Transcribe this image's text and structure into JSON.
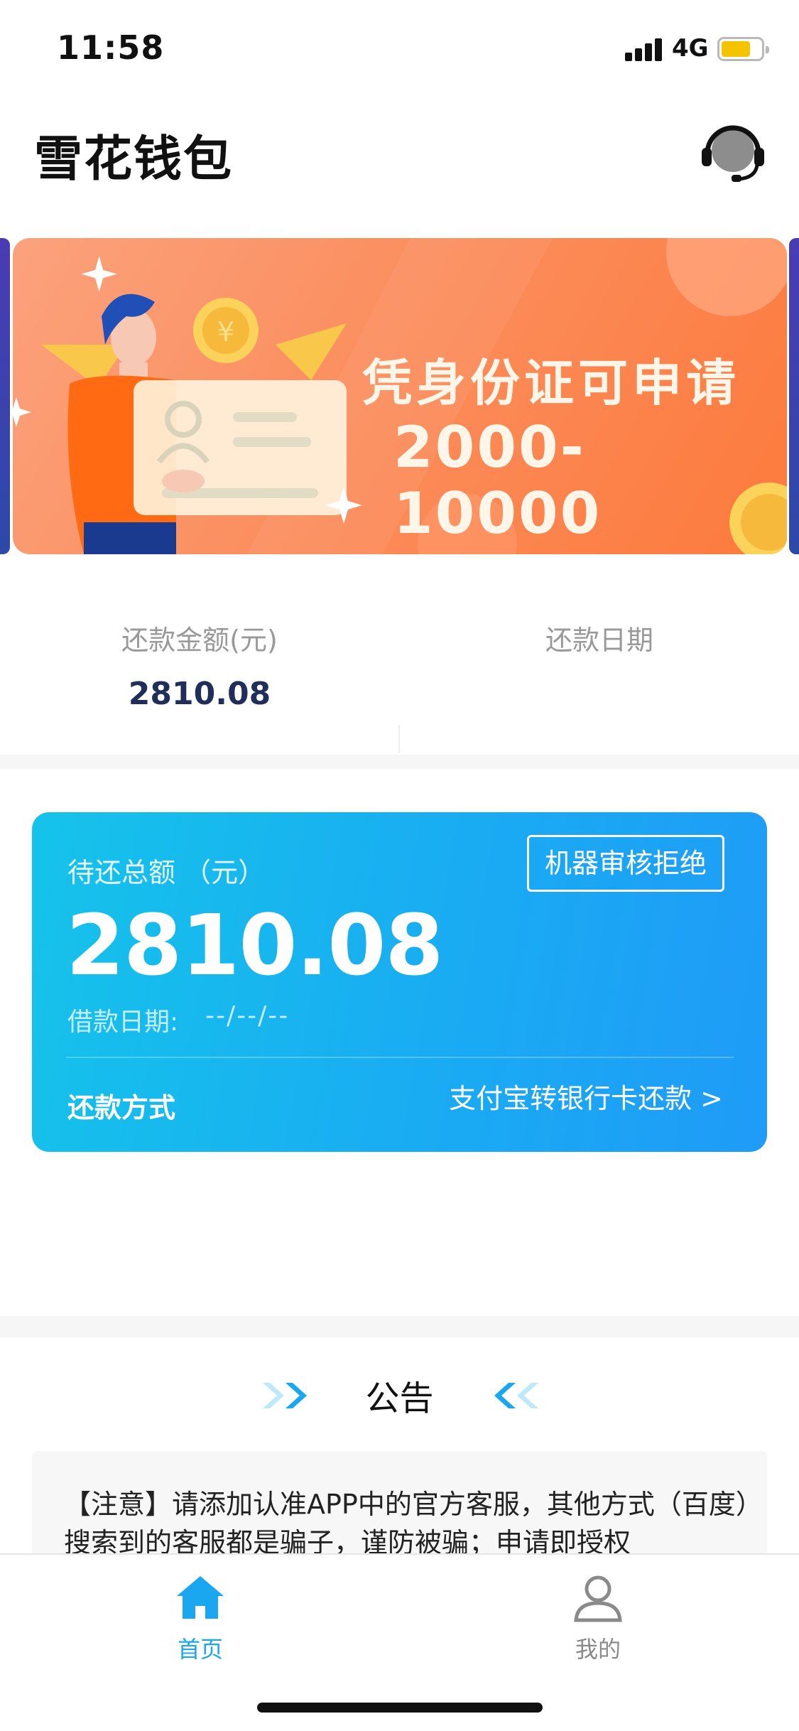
{
  "status_bar": {
    "time": "11:58",
    "network": "4G"
  },
  "header": {
    "title": "雪花钱包"
  },
  "banner": {
    "line1": "凭身份证可申请",
    "line2": "2000-10000"
  },
  "summary": {
    "amount_label": "还款金额(元)",
    "amount_value": "2810.08",
    "date_label": "还款日期",
    "date_value": ""
  },
  "payment_card": {
    "total_label": "待还总额 （元）",
    "status_badge": "机器审核拒绝",
    "total_amount": "2810.08",
    "loan_date_label": "借款日期:",
    "loan_date_value": "--/--/--",
    "method_label": "还款方式",
    "method_link": "支付宝转银行卡还款 >"
  },
  "notice": {
    "title": "公告",
    "text": "【注意】请添加认准APP中的官方客服，其他方式（百度）搜索到的客服都是骗子，谨防被骗；申请即授权"
  },
  "tab_bar": {
    "items": [
      {
        "label": "首页",
        "icon": "home-icon",
        "active": true
      },
      {
        "label": "我的",
        "icon": "user-icon",
        "active": false
      }
    ]
  },
  "colors": {
    "accent": "#1aa7ef",
    "card_gradient_start": "#15c3ea",
    "card_gradient_end": "#1f9bf7",
    "banner_orange": "#fd7a3c",
    "amount_navy": "#1f2f5a"
  }
}
